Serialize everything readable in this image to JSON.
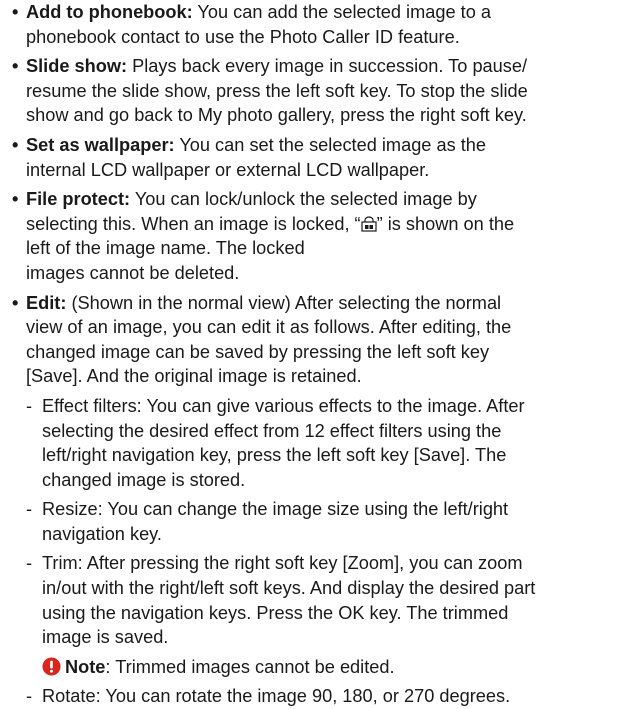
{
  "items": [
    {
      "title": "Add to phonebook:",
      "lines": [
        " You can add the selected image to a",
        "phonebook contact to use the Photo Caller ID feature."
      ]
    },
    {
      "title": "Slide show:",
      "lines": [
        " Plays back every image in succession. To pause/",
        "resume the slide show, press the left soft key. To stop the slide",
        "show and go back to My photo gallery, press the right soft key."
      ]
    },
    {
      "title": "Set as wallpaper:",
      "lines": [
        " You can set the selected image as the",
        "internal LCD wallpaper or external LCD wallpaper."
      ]
    },
    {
      "title": "File protect:",
      "lines": [
        " You can lock/unlock the selected image by",
        "selecting this. When an image is locked, “",
        "” is shown on the",
        "left of the image name. The locked",
        "images cannot be deleted."
      ]
    },
    {
      "title": "Edit:",
      "lines": [
        " (Shown in the normal view) After selecting the normal",
        "view of an image, you can edit it as follows. After editing, the",
        "changed image can be saved by pressing the left soft key",
        "[Save]. And the original image is retained."
      ]
    }
  ],
  "edit_options": [
    {
      "lines": [
        "Effect filters: You can give various effects to the image. After",
        "selecting the desired effect from 12 effect filters using the",
        "left/right navigation key, press the left soft key [Save]. The",
        "changed image is stored."
      ]
    },
    {
      "lines": [
        "Resize: You can change the image size using the left/right",
        "navigation key."
      ]
    },
    {
      "lines": [
        "Trim: After pressing the right soft key [Zoom], you can zoom",
        "in/out with the right/left soft keys. And display the desired part",
        "using the navigation keys. Press the OK key. The trimmed",
        "image is saved."
      ]
    }
  ],
  "note": {
    "label": "Note",
    "text": ": Trimmed images cannot be edited."
  },
  "rotate": {
    "lines": [
      "Rotate: You can rotate the image 90, 180, or 270 degrees."
    ]
  },
  "bullet_char": "•",
  "dash_char": "-",
  "colors": {
    "text": "#1a1a1a",
    "note_icon": "#d9261c"
  }
}
